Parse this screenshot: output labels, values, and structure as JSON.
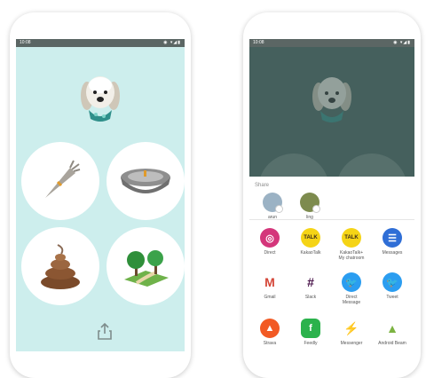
{
  "left_phone": {
    "status_time": "10:08",
    "status_icons": "◉ ▾◢▮",
    "tiles": [
      {
        "name": "carrot"
      },
      {
        "name": "food-bowl"
      },
      {
        "name": "poop"
      },
      {
        "name": "park"
      }
    ],
    "share_icon": "share-icon"
  },
  "right_phone": {
    "status_time": "10:08",
    "status_icons": "◉ ▾◢▮",
    "share_title": "Share",
    "contacts": [
      {
        "label": "arun"
      },
      {
        "label": "ling"
      }
    ],
    "apps": [
      {
        "label": "Direct",
        "icon": "instagram-icon",
        "color": "#d4367b"
      },
      {
        "label": "KakaoTalk",
        "icon": "kakaotalk-icon",
        "color": "#f5d416"
      },
      {
        "label": "KakaoTalk+\nMy chatroom",
        "icon": "kakaotalk-icon",
        "color": "#f5d416"
      },
      {
        "label": "Messages",
        "icon": "messages-icon",
        "color": "#2f6ed6"
      },
      {
        "label": "Gmail",
        "icon": "gmail-icon",
        "color": "#ffffff"
      },
      {
        "label": "Slack",
        "icon": "slack-icon",
        "color": "#ffffff"
      },
      {
        "label": "Direct\nMessage",
        "icon": "twitter-icon",
        "color": "#2b9df0"
      },
      {
        "label": "Tweet",
        "icon": "twitter-icon",
        "color": "#2b9df0"
      },
      {
        "label": "Strava",
        "icon": "strava-icon",
        "color": "#f25a24"
      },
      {
        "label": "Feedly",
        "icon": "feedly-icon",
        "color": "#2bb24c"
      },
      {
        "label": "Messenger",
        "icon": "messenger-icon",
        "color": "#ffffff"
      },
      {
        "label": "Android Beam",
        "icon": "android-icon",
        "color": "#ffffff"
      }
    ]
  }
}
